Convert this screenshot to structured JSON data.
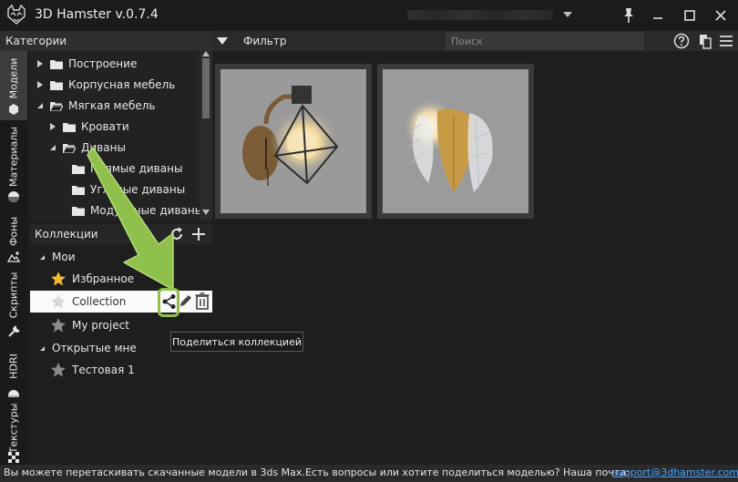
{
  "window": {
    "title": "3D Hamster v.0.7.4",
    "buttons": [
      "pin-icon",
      "minimize-icon",
      "maximize-icon",
      "close-icon"
    ]
  },
  "categories": {
    "header": "Категории",
    "items": [
      {
        "label": "Построение",
        "level": 1,
        "expanded": false
      },
      {
        "label": "Корпусная мебель",
        "level": 1,
        "expanded": false
      },
      {
        "label": "Мягкая мебель",
        "level": 1,
        "expanded": true
      },
      {
        "label": "Кровати",
        "level": 2,
        "expanded": false
      },
      {
        "label": "Диваны",
        "level": 2,
        "expanded": true
      },
      {
        "label": "Прямые диваны",
        "level": 3
      },
      {
        "label": "Угловые диваны",
        "level": 3
      },
      {
        "label": "Модульные диваны",
        "level": 3
      }
    ]
  },
  "filter": {
    "label": "Фильтр",
    "search_placeholder": "Поиск",
    "icons": [
      "help-icon",
      "copy-icon",
      "menu-icon"
    ]
  },
  "side_tabs": [
    {
      "label": "Модели",
      "icon": "model-icon",
      "active": true
    },
    {
      "label": "Материалы",
      "icon": "material-icon",
      "active": false
    },
    {
      "label": "Фоны",
      "icon": "background-icon",
      "active": false
    },
    {
      "label": "Скрипты",
      "icon": "wrench-icon",
      "active": false
    },
    {
      "label": "HDRI",
      "icon": "hdri-icon",
      "active": false
    },
    {
      "label": "Текстуры",
      "icon": "texture-icon",
      "active": false
    }
  ],
  "collections": {
    "header": "Коллекции",
    "groups": [
      {
        "label": "Мои",
        "items": [
          {
            "label": "Избранное",
            "star": "gold"
          },
          {
            "label": "Collection",
            "star": "grey",
            "selected": true
          },
          {
            "label": "My project",
            "star": "grey"
          }
        ]
      },
      {
        "label": "Открытые мне",
        "items": [
          {
            "label": "Тестовая 1",
            "star": "grey"
          }
        ]
      }
    ]
  },
  "tooltip": "Поделиться коллекцией",
  "colors": {
    "accent_green": "#8fc04b",
    "star_gold": "#f5b82e",
    "link": "#4aa3ff"
  },
  "status": {
    "left": "Вы можете перетаскивать скачанные модели в 3ds Max.",
    "right": "Есть вопросы или хотите поделиться моделью? Наша почта:",
    "email": "support@3dhamster.com"
  }
}
